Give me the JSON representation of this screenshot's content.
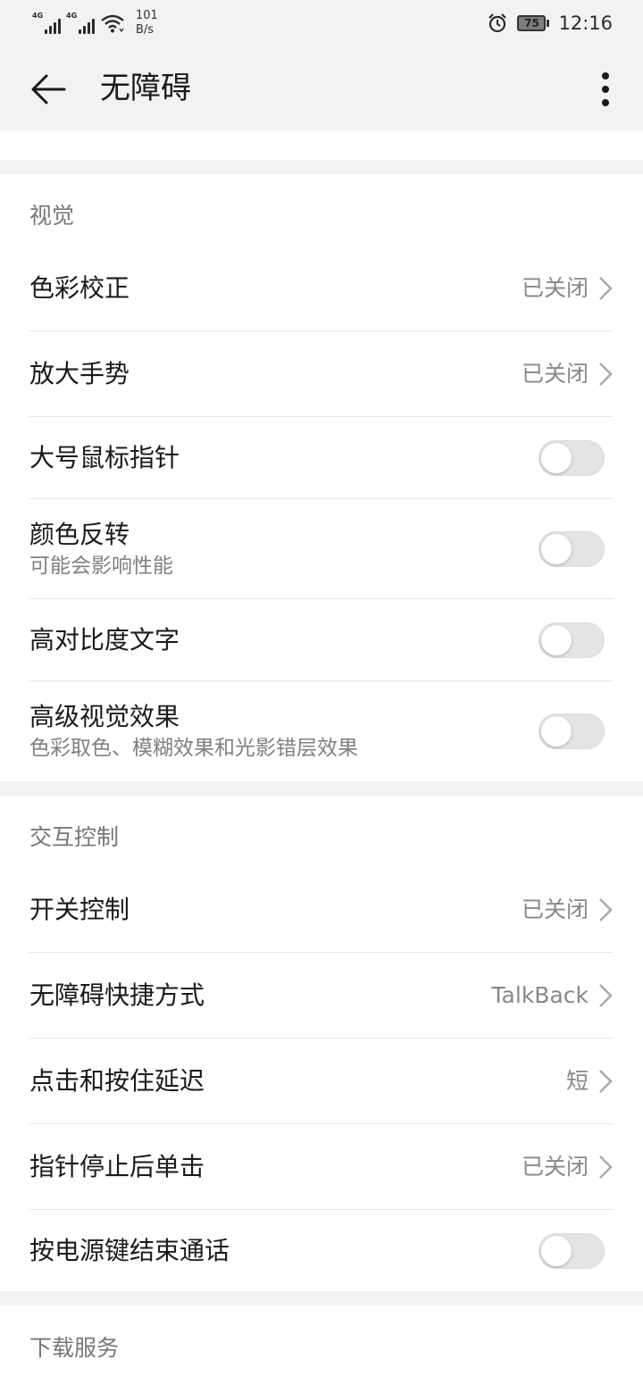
{
  "status_bar": {
    "signal1_label": "4G",
    "signal2_label": "4G",
    "speed_value": "101",
    "speed_unit": "B/s",
    "battery_level": "75",
    "time": "12:16"
  },
  "app_bar": {
    "title": "无障碍",
    "back_icon": "arrow-left-icon",
    "more_icon": "more-vertical-icon"
  },
  "sections": {
    "vision": {
      "header": "视觉",
      "items": [
        {
          "title": "色彩校正",
          "value": "已关闭",
          "type": "link"
        },
        {
          "title": "放大手势",
          "value": "已关闭",
          "type": "link"
        },
        {
          "title": "大号鼠标指针",
          "type": "toggle",
          "on": false
        },
        {
          "title": "颜色反转",
          "subtitle": "可能会影响性能",
          "type": "toggle",
          "on": false
        },
        {
          "title": "高对比度文字",
          "type": "toggle",
          "on": false
        },
        {
          "title": "高级视觉效果",
          "subtitle": "色彩取色、模糊效果和光影错层效果",
          "type": "toggle",
          "on": false
        }
      ]
    },
    "interaction": {
      "header": "交互控制",
      "items": [
        {
          "title": "开关控制",
          "value": "已关闭",
          "type": "link"
        },
        {
          "title": "无障碍快捷方式",
          "value": "TalkBack",
          "type": "link"
        },
        {
          "title": "点击和按住延迟",
          "value": "短",
          "type": "link"
        },
        {
          "title": "指针停止后单击",
          "value": "已关闭",
          "type": "link"
        },
        {
          "title": "按电源键结束通话",
          "type": "toggle",
          "on": false
        }
      ]
    },
    "download": {
      "header": "下载服务"
    }
  },
  "colors": {
    "background": "#ffffff",
    "gap": "#f2f2f2",
    "toggle_off": "#e4e4e4",
    "secondary_text": "#888888"
  }
}
